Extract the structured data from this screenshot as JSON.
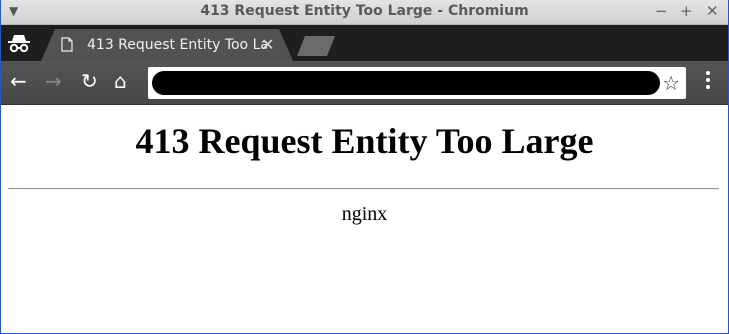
{
  "window": {
    "title": "413 Request Entity Too Large - Chromium",
    "menu_icon": "triangle-down-icon",
    "controls": [
      "−",
      "+",
      "✕"
    ]
  },
  "tabs": [
    {
      "label": "413 Request Entity Too Large",
      "icon": "page-icon",
      "active": true
    }
  ],
  "toolbar": {
    "back_icon": "←",
    "forward_icon": "→",
    "reload_icon": "↻",
    "home_icon": "⌂",
    "bookmark_icon": "☆",
    "close_tab_icon": "✕",
    "url_redacted": true
  },
  "page": {
    "heading": "413 Request Entity Too Large",
    "server": "nginx"
  },
  "colors": {
    "desktop": "#2a57c8",
    "tabstrip": "#1e1e1e",
    "active_tab": "#525252",
    "toolbar": "#4e4e4e"
  }
}
